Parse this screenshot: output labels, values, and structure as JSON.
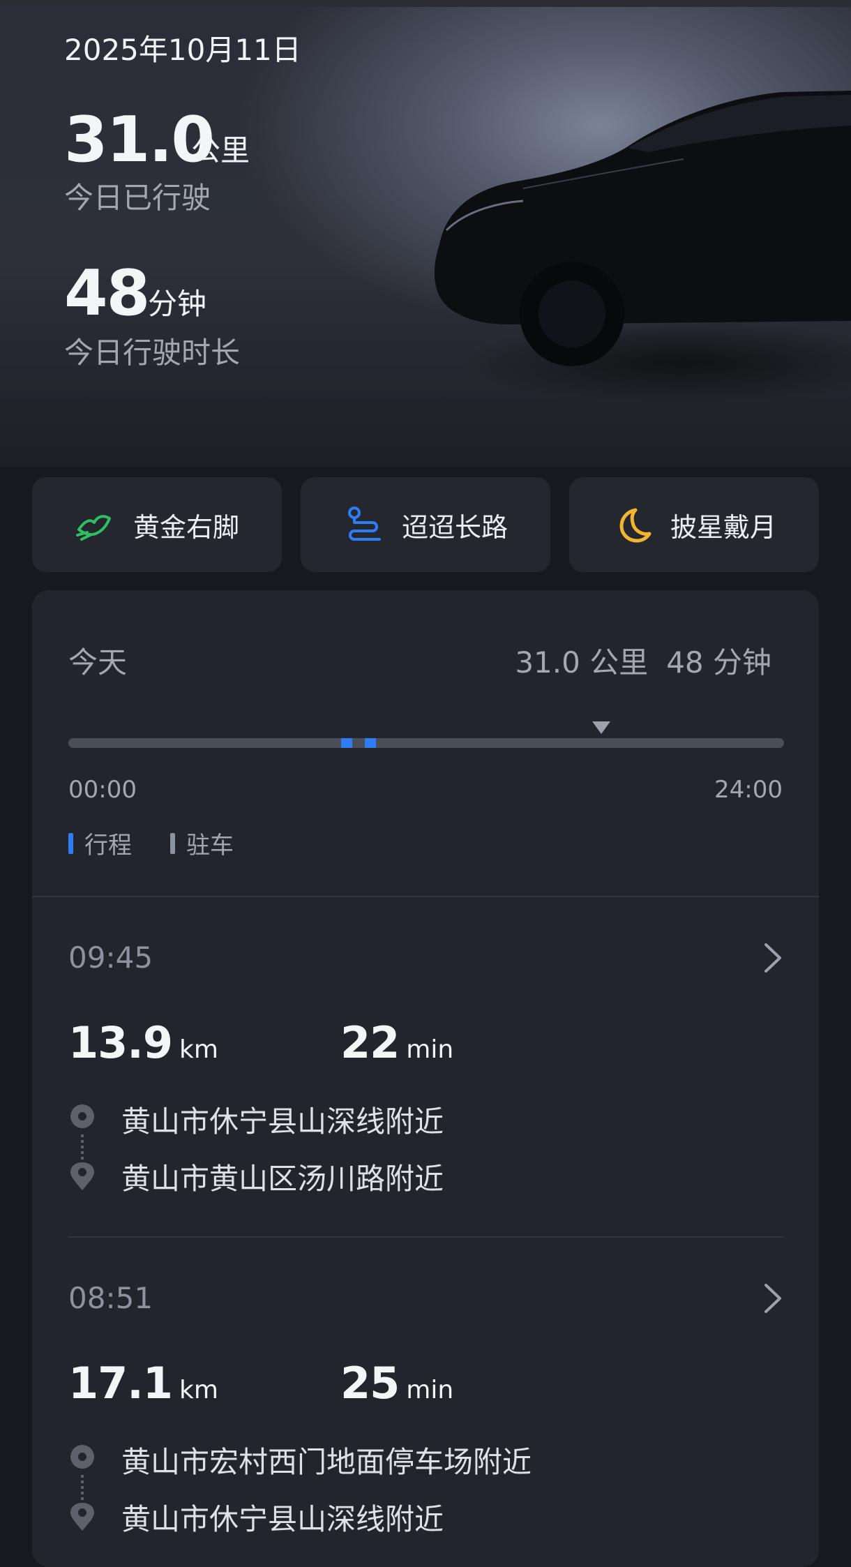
{
  "header": {
    "date": "2025年10月11日",
    "distance_value": "31.0",
    "distance_unit": "公里",
    "distance_label": "今日已行驶",
    "duration_value": "48",
    "duration_unit": "分钟",
    "duration_label": "今日行驶时长"
  },
  "badges": [
    {
      "label": "黄金右脚",
      "icon": "golden-foot-icon",
      "color": "#2fbf62"
    },
    {
      "label": "迢迢长路",
      "icon": "long-road-icon",
      "color": "#2f7df6"
    },
    {
      "label": "披星戴月",
      "icon": "moon-icon",
      "color": "#f2b530"
    }
  ],
  "summary": {
    "label": "今天",
    "distance": "31.0 公里",
    "duration": "48 分钟",
    "time_start": "00:00",
    "time_end": "24:00",
    "legend_trip": "行程",
    "legend_parking": "驻车",
    "trip_color": "#2f7df6",
    "parking_color": "#8d92a0"
  },
  "trips": [
    {
      "time": "09:45",
      "distance": "13.9",
      "distance_unit": "km",
      "duration": "22",
      "duration_unit": "min",
      "from": "黄山市休宁县山深线附近",
      "to": "黄山市黄山区汤川路附近"
    },
    {
      "time": "08:51",
      "distance": "17.1",
      "distance_unit": "km",
      "duration": "25",
      "duration_unit": "min",
      "from": "黄山市宏村西门地面停车场附近",
      "to": "黄山市休宁县山深线附近"
    }
  ]
}
